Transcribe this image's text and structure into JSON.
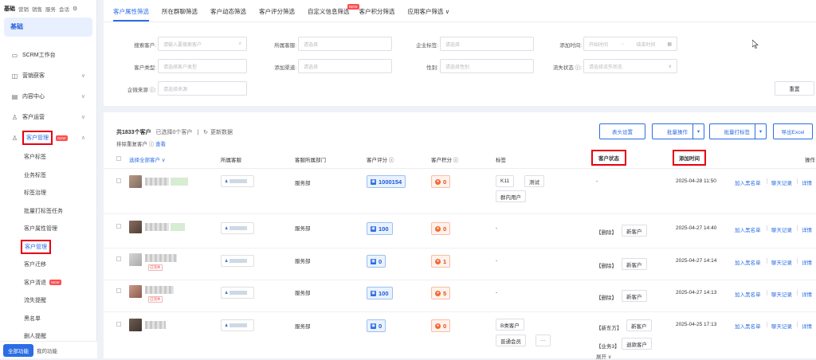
{
  "sidebar": {
    "top_tabs": [
      "基础",
      "营销",
      "销售",
      "服务",
      "会话"
    ],
    "title": "基础",
    "nav": [
      {
        "label": "SCRM工作台",
        "icon": "monitor-icon"
      },
      {
        "label": "营销获客",
        "icon": "marketing-icon"
      },
      {
        "label": "内容中心",
        "icon": "content-icon"
      },
      {
        "label": "客户运营",
        "icon": "user-ops-icon"
      },
      {
        "label": "客户管理",
        "icon": "customer-icon",
        "badge": "NEW"
      }
    ],
    "sub_items": [
      "客户标签",
      "业务标签",
      "标签治理",
      "批量打标签任务",
      "客户属性管理",
      "客户管理",
      "客户迁移",
      "客户清退",
      "流失提醒",
      "黑名单",
      "删人提醒"
    ],
    "sub_badge": "NEW",
    "all_functions": "全部功能",
    "my_functions": "我的功能"
  },
  "tabs": [
    {
      "label": "客户属性筛选"
    },
    {
      "label": "所在群聊筛选"
    },
    {
      "label": "客户动态筛选"
    },
    {
      "label": "客户评分筛选"
    },
    {
      "label": "自定义信息筛选",
      "badge": "NEW"
    },
    {
      "label": "客户积分筛选"
    },
    {
      "label": "应用客户筛选"
    }
  ],
  "filters": {
    "search_label": "搜索客户:",
    "search_ph": "请输入要搜索客户",
    "staff_label": "所属客服:",
    "staff_ph": "请选择",
    "corp_tag_label": "企业标签:",
    "corp_tag_ph": "请选择",
    "add_time_label": "添加时间:",
    "start_ph": "开始时间",
    "to": "→",
    "end_ph": "结束时间",
    "type_label": "客户类型:",
    "type_ph": "请选择客户类型",
    "channel_label": "添加渠道:",
    "channel_ph": "请选择",
    "gender_label": "性别:",
    "gender_ph": "请选择性别",
    "churn_label": "流失状态 ⓘ:",
    "churn_ph": "请选择流失状态",
    "source_label": "企微来源 ⓘ:",
    "source_ph": "请选择来源",
    "reset": "重置"
  },
  "list": {
    "total": "共1833个客户",
    "selected": "已选择0个客户",
    "refresh": "更新数据",
    "exclude": "排除重复客户 ⓘ",
    "view": "查看",
    "buttons": {
      "col_settings": "表头设置",
      "batch_ops": "批量操作",
      "batch_tag": "批量打标签",
      "export": "导出Excel"
    },
    "headers": {
      "select_all": "选择全部客户",
      "staff": "所属客服",
      "dept": "客服所属部门",
      "score": "客户评分 ⓘ",
      "points": "客户积分 ⓘ",
      "tags": "标签",
      "status": "客户状态",
      "add_time": "添加时间",
      "ops": "操作"
    }
  },
  "rows": [
    {
      "dept": "服务部",
      "score": "1000154",
      "points": "0",
      "tags": [
        "K11",
        "测试",
        "群内用户"
      ],
      "status_text": "-",
      "status_tags": [],
      "time": "2025-04-28 11:50"
    },
    {
      "dept": "服务部",
      "score": "100",
      "points": "0",
      "tags": [],
      "tag_dash": "-",
      "status_text": "【删除】",
      "status_tags": [
        "新客户"
      ],
      "time": "2025-04-27 14:40"
    },
    {
      "dept": "服务部",
      "score": "0",
      "points": "1",
      "tags": [],
      "tag_dash": "-",
      "status_text": "【删除】",
      "status_tags": [
        "新客户"
      ],
      "time": "2025-04-27 14:14",
      "red_tag": "已流失"
    },
    {
      "dept": "服务部",
      "score": "100",
      "points": "5",
      "tags": [],
      "tag_dash": "-",
      "status_text": "【删除】",
      "status_tags": [
        "新客户"
      ],
      "time": "2025-04-27 14:13",
      "red_tag": "已流失"
    },
    {
      "dept": "服务部",
      "score": "0",
      "points": "0",
      "tags": [
        "B类客户",
        "普通会员",
        "···"
      ],
      "status_text": "【新东方】",
      "status_tags": [
        "新客户"
      ],
      "status_text2": "【业务3】",
      "status_tags2": [
        "退款客户"
      ],
      "expand": "展开 ∨",
      "time": "2025-04-25 17:13"
    }
  ],
  "ops": {
    "blacklist": "加入黑名单",
    "chat": "聊天记录",
    "detail": "详情"
  }
}
